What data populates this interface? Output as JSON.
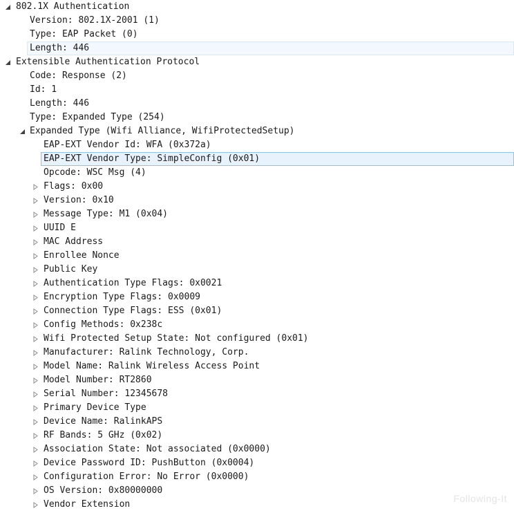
{
  "tree": {
    "eapol": {
      "label": "802.1X Authentication",
      "version": "Version: 802.1X-2001 (1)",
      "type": "Type: EAP Packet (0)",
      "length": "Length: 446"
    },
    "eap": {
      "label": "Extensible Authentication Protocol",
      "code": "Code: Response (2)",
      "id": "Id: 1",
      "length": "Length: 446",
      "type": "Type: Expanded Type (254)",
      "expanded": {
        "label": "Expanded Type (Wifi Alliance, WifiProtectedSetup)",
        "vendor_id": "EAP-EXT Vendor Id: WFA (0x372a)",
        "vendor_type": "EAP-EXT Vendor Type: SimpleConfig (0x01)",
        "opcode": "Opcode: WSC Msg (4)",
        "items": [
          "Flags: 0x00",
          "Version: 0x10",
          "Message Type: M1 (0x04)",
          "UUID E",
          "MAC Address",
          "Enrollee Nonce",
          "Public Key",
          "Authentication Type Flags: 0x0021",
          "Encryption Type Flags: 0x0009",
          "Connection Type Flags: ESS (0x01)",
          "Config Methods: 0x238c",
          "Wifi Protected Setup State: Not configured (0x01)",
          "Manufacturer: Ralink Technology, Corp.",
          "Model Name: Ralink Wireless Access Point",
          "Model Number: RT2860",
          "Serial Number: 12345678",
          "Primary Device Type",
          "Device Name: RalinkAPS",
          "RF Bands: 5 GHz (0x02)",
          "Association State: Not associated (0x0000)",
          "Device Password ID: PushButton (0x0004)",
          "Configuration Error: No Error (0x0000)",
          "OS Version: 0x80000000",
          "Vendor Extension"
        ]
      }
    }
  },
  "watermark": "Following-It",
  "icons": {
    "expanded": "triangle-down-icon",
    "collapsed": "triangle-right-icon"
  },
  "colors": {
    "selection_strong": "#e7f2fc",
    "selection_border": "#8fc1ea",
    "selection_light": "#f2f8fd",
    "toggle_dark": "#404040",
    "toggle_light": "#8a8a8a"
  }
}
